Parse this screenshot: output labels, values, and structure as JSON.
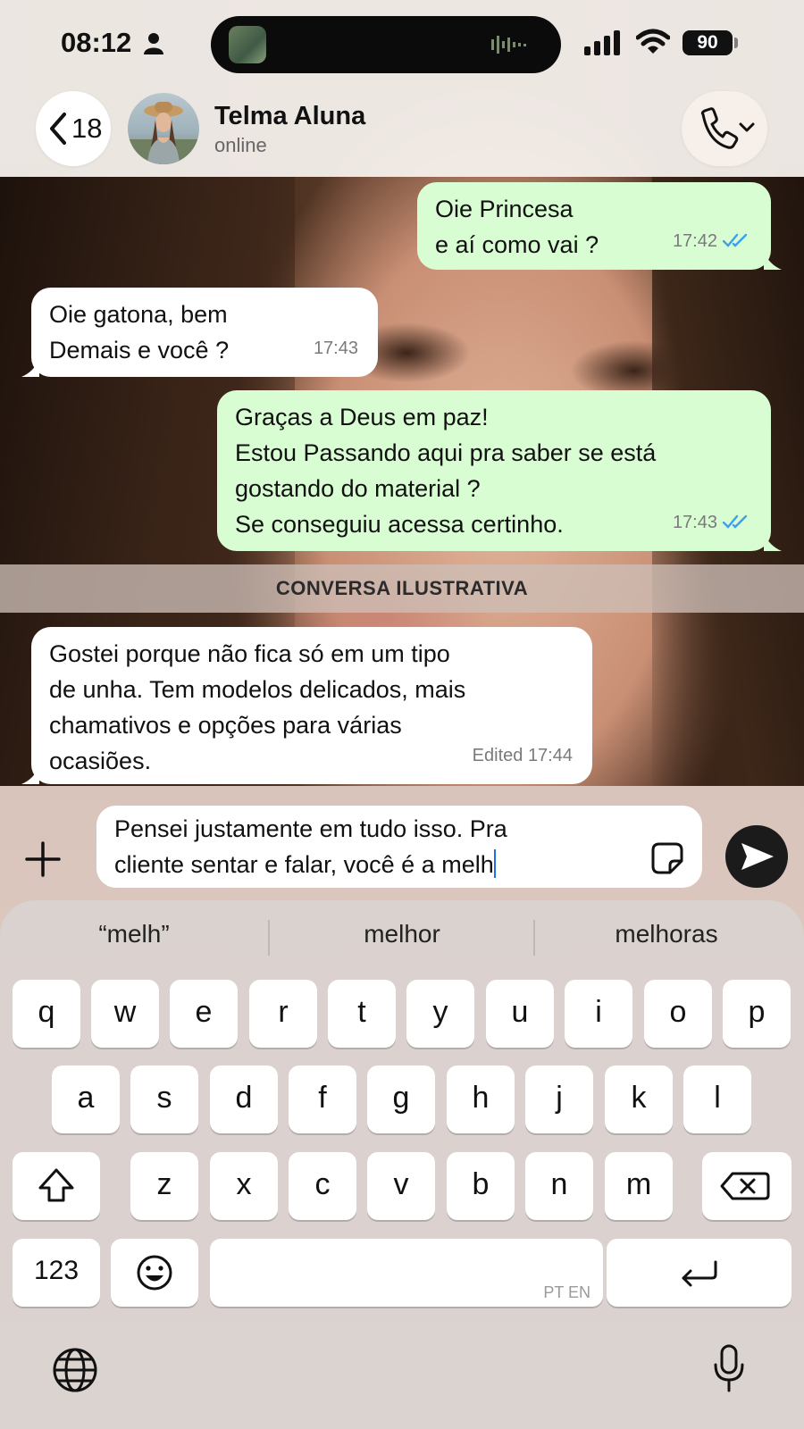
{
  "status_bar": {
    "time": "08:12",
    "battery": "90"
  },
  "header": {
    "back_count": "18",
    "contact_name": "Telma Aluna",
    "contact_status": "online"
  },
  "messages": [
    {
      "direction": "out",
      "lines": [
        "Oie Princesa",
        "e aí como vai ?"
      ],
      "time": "17:42",
      "read": true
    },
    {
      "direction": "in",
      "lines": [
        "Oie gatona, bem",
        "Demais e você ?"
      ],
      "time": "17:43"
    },
    {
      "direction": "out",
      "lines": [
        "Graças a Deus em paz!",
        "Estou Passando aqui pra saber se está",
        "gostando do material ?",
        "Se conseguiu acessa certinho."
      ],
      "time": "17:43",
      "read": true
    },
    {
      "direction": "in",
      "lines": [
        "Gostei porque não fica só em um tipo",
        "de unha. Tem modelos delicados, mais",
        "chamativos e opções para várias",
        "ocasiões."
      ],
      "time": "Edited 17:44"
    }
  ],
  "banner_text": "CONVERSA ILUSTRATIVA",
  "composer": {
    "line1": "Pensei justamente em tudo isso. Pra",
    "line2": "cliente sentar e falar, você é a melh"
  },
  "keyboard": {
    "suggestions": [
      "“melh”",
      "melhor",
      "melhoras"
    ],
    "row1": [
      "q",
      "w",
      "e",
      "r",
      "t",
      "y",
      "u",
      "i",
      "o",
      "p"
    ],
    "row2": [
      "a",
      "s",
      "d",
      "f",
      "g",
      "h",
      "j",
      "k",
      "l"
    ],
    "row3": [
      "z",
      "x",
      "c",
      "v",
      "b",
      "n",
      "m"
    ],
    "numbers_label": "123",
    "space_hint": "PT EN"
  },
  "colors": {
    "outgoing_bubble": "#d9fdd3",
    "incoming_bubble": "#ffffff",
    "read_ticks": "#3aa0f0"
  }
}
